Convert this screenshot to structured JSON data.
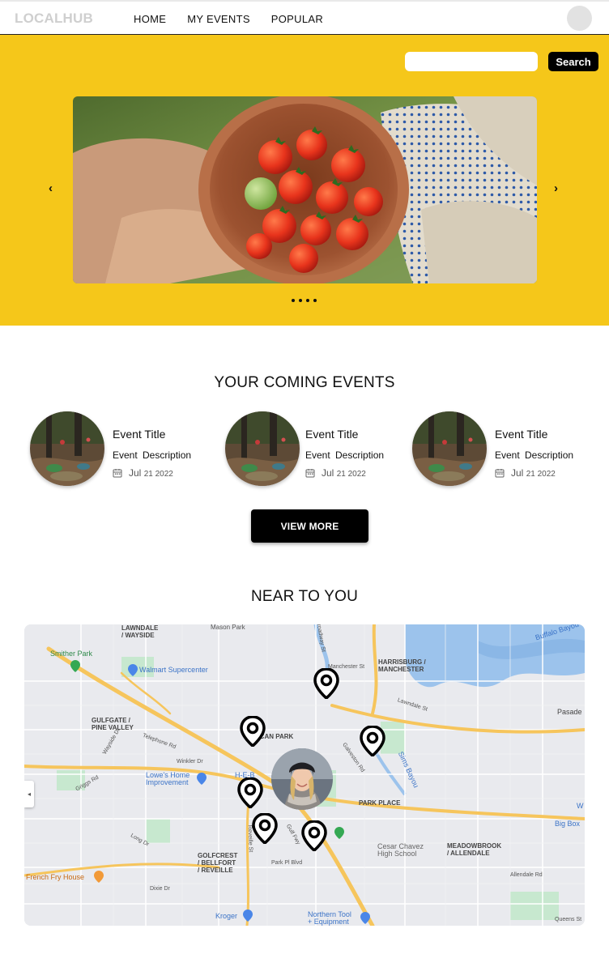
{
  "header": {
    "logo": "LOCALHUB",
    "nav": [
      "HOME",
      "MY EVENTS",
      "POPULAR"
    ]
  },
  "hero": {
    "search_placeholder": "",
    "search_button": "Search",
    "prev_arrow": "‹",
    "next_arrow": "›",
    "slide_count": 4
  },
  "events": {
    "title": "YOUR COMING EVENTS",
    "items": [
      {
        "title": "Event Title",
        "description": "Event Description",
        "date_month": "Jul",
        "date_rest": "21 2022"
      },
      {
        "title": "Event Title",
        "description": "Event Description",
        "date_month": "Jul",
        "date_rest": "21 2022"
      },
      {
        "title": "Event Title",
        "description": "Event Description",
        "date_month": "Jul",
        "date_rest": "21 2022"
      }
    ],
    "view_more": "VIEW MORE"
  },
  "near": {
    "title": "NEAR TO YOU",
    "map_labels": {
      "lawndale": "LAWNDALE\n/ WAYSIDE",
      "mason_park": "Mason Park",
      "buffalo_bayou": "Buffalo Bayou",
      "smither_park": "Smither Park",
      "walmart": "Walmart Supercenter",
      "harrisburg": "HARRISBURG /\nMANCHESTER",
      "pasadena": "Pasade",
      "gulfgate": "GULFGATE /\nPINE VALLEY",
      "pecan_park": "PECAN PARK",
      "lowes": "Lowe's Home\nImprovement",
      "heb": "H-E-B",
      "park_place": "PARK PLACE",
      "golfcrest": "GOLFCREST\n/ BELLFORT\n/ REVEILLE",
      "cesar_chavez": "Cesar Chavez\nHigh School",
      "meadowbrook": "MEADOWBROOK\n/ ALLENDALE",
      "big_box": "Big Box",
      "french_fry": "French Fry House",
      "kroger": "Kroger",
      "northern_tool": "Northern Tool\n+ Equipment",
      "manchester_st": "Manchester St",
      "lawndale_st": "Lawndale St",
      "telephone_rd": "Telephone Rd",
      "winkler_dr": "Winkler Dr",
      "griggs_rd": "Griggs Rd",
      "broadway_st": "Broadway St",
      "galveston_rd": "Galveston Rd",
      "gulf_fwy": "Gulf Fwy",
      "reveille_st": "Reveille St",
      "park_pl_blvd": "Park Pl Blvd",
      "dixie_dr": "Dixie Dr",
      "allendale_rd": "Allendale Rd",
      "queens_st": "Queens St",
      "sims_bayou": "Sims Bayou",
      "wayside_dr": "Wayside Dr",
      "long_dr": "Long Dr",
      "w_edge": "W"
    },
    "pins": 6
  },
  "colors": {
    "brand_yellow": "#f5c71a",
    "black": "#000000",
    "logo_grey": "#cfcfcf",
    "map_bg": "#e9eaee",
    "highway": "#f6c55c",
    "water": "#9cc3ec",
    "park": "#b6e1c0"
  }
}
